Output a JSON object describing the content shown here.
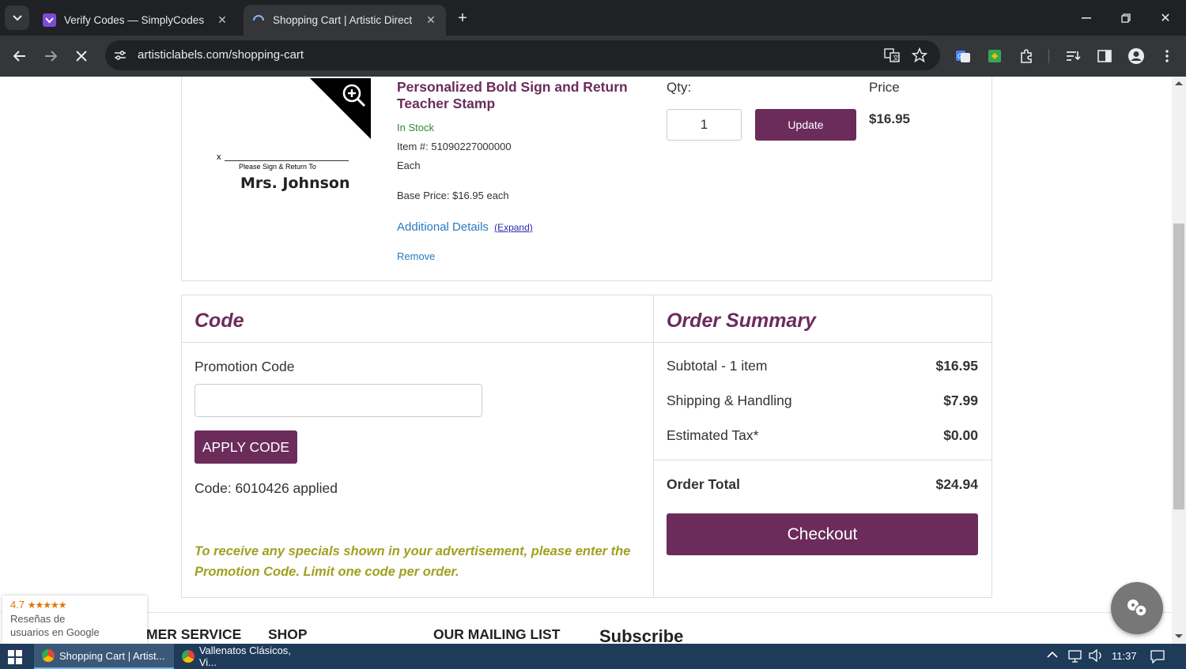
{
  "browser": {
    "tabs": [
      {
        "title": "Verify Codes — SimplyCodes",
        "active": false
      },
      {
        "title": "Shopping Cart | Artistic Direct",
        "active": true
      }
    ],
    "url": "artisticlabels.com/shopping-cart"
  },
  "product": {
    "stamp_small_text": "Please Sign & Return To",
    "stamp_name": "Mrs. Johnson",
    "stamp_x": "x",
    "title": "Personalized Bold Sign and Return Teacher Stamp",
    "stock": "In Stock",
    "item_number": "Item #: 51090227000000",
    "unit": "Each",
    "base_price": "Base Price: $16.95 each",
    "additional_details": "Additional Details",
    "expand": "(Expand)",
    "remove": "Remove",
    "qty_label": "Qty:",
    "qty_value": "1",
    "update_label": "Update",
    "price_label": "Price",
    "price_value": "$16.95"
  },
  "code": {
    "heading": "Code",
    "promo_label": "Promotion Code",
    "promo_value": "",
    "apply_label": "APPLY CODE",
    "applied_text": "Code: 6010426 applied",
    "note": "To receive any specials shown in your advertisement, please enter the Promotion Code. Limit one code per order."
  },
  "summary": {
    "heading": "Order Summary",
    "subtotal_label": "Subtotal - 1 item",
    "subtotal_value": "$16.95",
    "shipping_label": "Shipping & Handling",
    "shipping_value": "$7.99",
    "tax_label": "Estimated Tax*",
    "tax_value": "$0.00",
    "total_label": "Order Total",
    "total_value": "$24.94",
    "checkout_label": "Checkout"
  },
  "footer": {
    "customer_service": "MER SERVICE",
    "shop": "SHOP",
    "mailing_list": "OUR MAILING LIST",
    "subscribe": "Subscribe"
  },
  "google_badge": {
    "rating": "4.7",
    "stars": "★★★★★",
    "line1": "Reseñas de",
    "line2": "usuarios en Google"
  },
  "taskbar": {
    "items": [
      {
        "label": "Shopping Cart | Artist..."
      },
      {
        "label": "Vallenatos Clásicos, Vi..."
      }
    ],
    "time": "11:37"
  },
  "colors": {
    "brand": "#6b2c5c",
    "link": "#2a7abf",
    "in_stock": "#2e8b2e",
    "note": "#a0a020"
  }
}
